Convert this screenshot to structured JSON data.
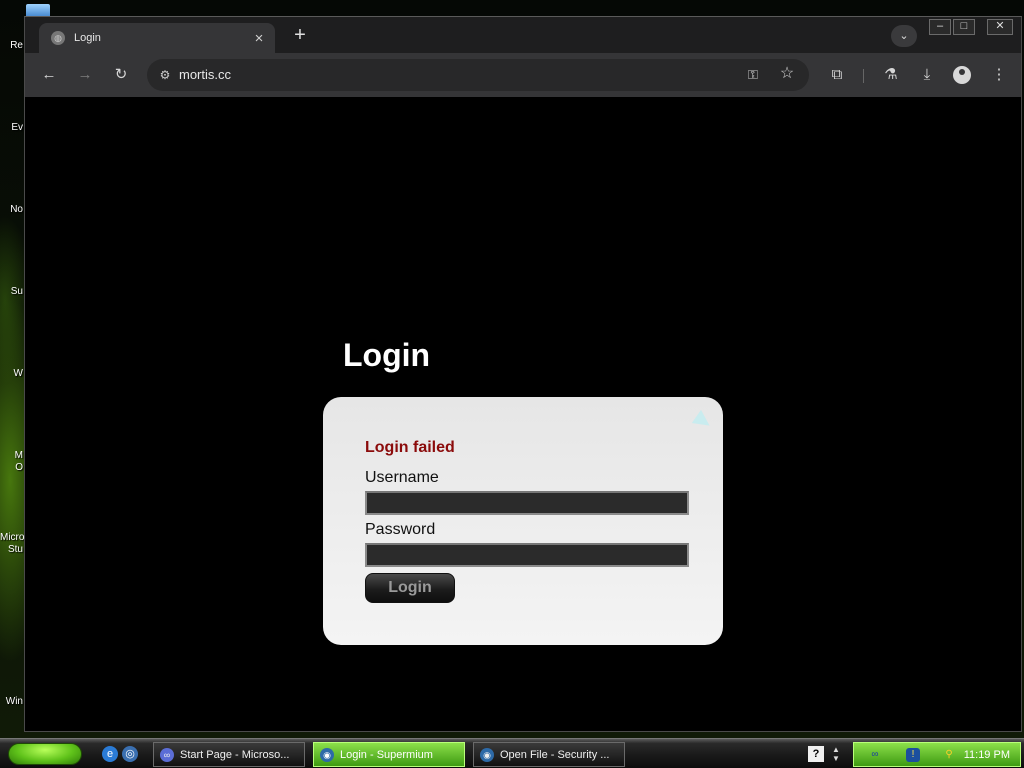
{
  "desktop": {
    "icon_labels": [
      "Re",
      "Ev",
      "No",
      "Su",
      "W",
      "M",
      "O",
      "Micro",
      "Stu",
      "Win"
    ]
  },
  "browser": {
    "tab": {
      "title": "Login"
    },
    "address": {
      "url": "mortis.cc"
    },
    "icons": {
      "back": "arrow-left-icon",
      "forward": "arrow-right-icon",
      "reload": "reload-icon",
      "site_info": "tune-icon",
      "passwords": "key-icon",
      "bookmark": "star-icon",
      "extensions": "puzzle-icon",
      "labs": "flask-icon",
      "downloads": "download-icon",
      "profile": "profile-icon",
      "menu": "kebab-menu-icon"
    }
  },
  "page": {
    "heading": "Login",
    "error": "Login failed",
    "username_label": "Username",
    "password_label": "Password",
    "username_value": "",
    "password_value": "",
    "login_button": "Login"
  },
  "taskbar": {
    "tasks": [
      {
        "label": "Start Page - Microso...",
        "active": false
      },
      {
        "label": "Login - Supermium",
        "active": true
      },
      {
        "label": "Open File - Security ...",
        "active": false
      }
    ],
    "clock": "11:19 PM"
  },
  "colors": {
    "error": "#8b0b0b",
    "taskbar_accent": "#5fc21a",
    "browser_chrome": "#353537"
  }
}
